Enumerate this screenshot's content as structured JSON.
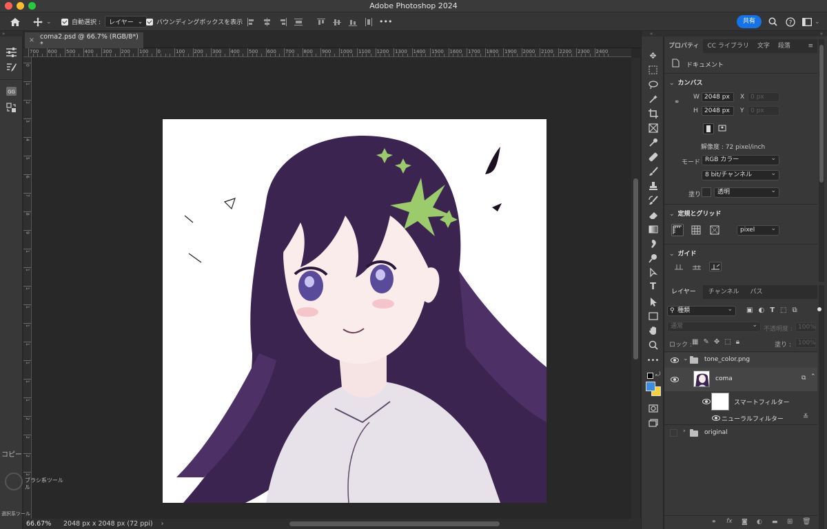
{
  "window": {
    "title": "Adobe Photoshop 2024",
    "traffic_colors": [
      "#fe5f57",
      "#febc2e",
      "#28c840"
    ]
  },
  "options_bar": {
    "auto_select_label": "自動選択 :",
    "auto_select_value": "レイヤー",
    "bounding_box_label": "バウンディングボックスを表示",
    "more_label": "•••",
    "share_label": "共有"
  },
  "document": {
    "tab_label": "coma2.psd @ 66.7% (RGB/8*) *",
    "close_glyph": "×"
  },
  "rulers": {
    "h_labels": [
      "700",
      "600",
      "500",
      "400",
      "300",
      "200",
      "100",
      "0",
      "100",
      "200",
      "300",
      "400",
      "500",
      "600",
      "700",
      "800",
      "900",
      "1000",
      "1100",
      "1200",
      "1300",
      "1400",
      "1500",
      "1600",
      "1700",
      "1800",
      "1900",
      "2000",
      "2100",
      "2200",
      "2300",
      "2400"
    ],
    "v_labels": [
      "0",
      "1",
      "2",
      "3",
      "4",
      "5",
      "6",
      "7",
      "8",
      "9",
      "1",
      "1",
      "1",
      "1",
      "1",
      "1",
      "1",
      "1",
      "1",
      "2",
      "2",
      "2",
      "2"
    ]
  },
  "status": {
    "zoom": "66.67%",
    "doc_size": "2048 px x 2048 px (72 ppi)",
    "arrow": "›"
  },
  "floating_hints": {
    "copy": "コピー",
    "brush": "ブラシ系ツール",
    "brush_sub": "ル",
    "select_tools": "選択系ツール"
  },
  "properties": {
    "tabs": [
      "プロパティ",
      "CC ライブラリ",
      "文字",
      "段落"
    ],
    "doc_label": "ドキュメント",
    "canvas_title": "カンバス",
    "w_label": "W",
    "w_value": "2048 px",
    "h_label": "H",
    "h_value": "2048 px",
    "x_label": "X",
    "x_placeholder": "0 px",
    "y_label": "Y",
    "y_placeholder": "0 px",
    "resolution": "解像度 : 72 pixel/inch",
    "mode_label": "モード",
    "mode_value": "RGB カラー",
    "bit_value": "8 bit/チャンネル",
    "fill_label": "塗り",
    "fill_value": "透明",
    "rulers_grid_title": "定規とグリッド",
    "unit_value": "pixel",
    "guides_title": "ガイド"
  },
  "layers_panel": {
    "tabs": [
      "レイヤー",
      "チャンネル",
      "パス"
    ],
    "filter_value": "種類",
    "blend_value": "通常",
    "opacity_label": "不透明度 :",
    "opacity_value": "100%",
    "lock_label": "ロック :",
    "fill_label": "塗り :",
    "fill_value": "100%",
    "layers": [
      {
        "name": "tone_color.png",
        "type": "group"
      },
      {
        "name": "coma",
        "type": "smart"
      },
      {
        "name": "スマートフィルター",
        "type": "filter-mask"
      },
      {
        "name": "ニューラルフィルター",
        "type": "filter"
      },
      {
        "name": "original",
        "type": "group"
      }
    ]
  },
  "colors": {
    "foreground": "#3d8bdc",
    "background": "#f5d23b",
    "accent": "#1473e6",
    "hair": "#3b2450",
    "hair_mid": "#4d3166",
    "leaf": "#9ccb6c"
  }
}
